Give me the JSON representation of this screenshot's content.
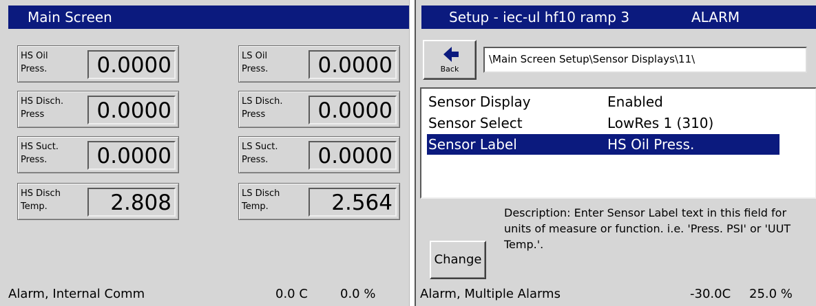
{
  "colors": {
    "titlebar": "#0b1a7e",
    "panel_bg": "#d6d6d6",
    "selection": "#0b1a7e"
  },
  "main_screen": {
    "title": "Main Screen",
    "sensors": [
      {
        "label": "HS Oil\nPress.",
        "value": "0.0000"
      },
      {
        "label": "LS Oil\nPress.",
        "value": "0.0000"
      },
      {
        "label": "HS Disch.\nPress",
        "value": "0.0000"
      },
      {
        "label": "LS Disch.\nPress",
        "value": "0.0000"
      },
      {
        "label": "HS Suct.\nPress.",
        "value": "0.0000"
      },
      {
        "label": "LS Suct.\nPress.",
        "value": "0.0000"
      },
      {
        "label": "HS Disch\nTemp.",
        "value": "2.808"
      },
      {
        "label": "LS Disch\nTemp.",
        "value": "2.564"
      }
    ],
    "status": {
      "message": "Alarm, Internal Comm",
      "temperature": "0.0 C",
      "percent": "0.0 %"
    }
  },
  "setup_screen": {
    "title": "Setup - iec-ul hf10 ramp 3",
    "alarm": "ALARM",
    "back_label": "Back",
    "back_icon": "left-arrow-icon",
    "path": "\\Main Screen Setup\\Sensor Displays\\11\\",
    "rows": [
      {
        "name": "Sensor Display",
        "value": "Enabled"
      },
      {
        "name": "Sensor Select",
        "value": "LowRes 1 (310)"
      },
      {
        "name": "Sensor Label",
        "value": "HS Oil Press."
      }
    ],
    "selected_row": "Sensor Label",
    "description": "Description:  Enter Sensor Label text in this field for units of measure or function. i.e. 'Press. PSI' or 'UUT Temp.'.",
    "change_label": "Change",
    "status": {
      "message": "Alarm, Multiple Alarms",
      "temperature": "-30.0C",
      "percent": "25.0 %"
    }
  }
}
